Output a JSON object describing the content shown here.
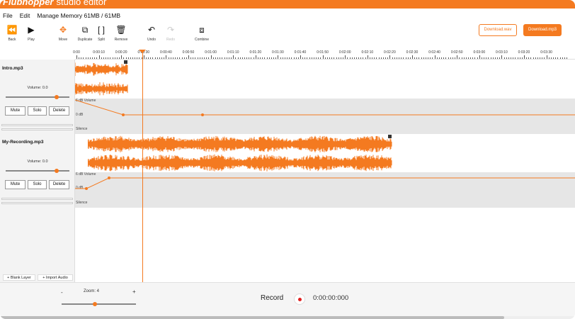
{
  "app": {
    "brand": "Flubhopper",
    "brand_sub": "studio editor"
  },
  "menu": {
    "file": "File",
    "edit": "Edit",
    "memory": "Manage Memory 61MB / 61MB"
  },
  "toolbar": {
    "back": "Back",
    "play": "Play",
    "move": "Move",
    "duplicate": "Duplicate",
    "split": "Split",
    "remove": "Remove",
    "undo": "Undo",
    "redo": "Redo",
    "combine": "Combine",
    "download_wav": "Download.wav",
    "download_mp3": "Download.mp3"
  },
  "ruler": {
    "ticks": [
      "0:00",
      "0:00:10",
      "0:00:20",
      "0:00:30",
      "0:00:40",
      "0:00:50",
      "0:01:00",
      "0:01:10",
      "0:01:20",
      "0:01:30",
      "0:01:40",
      "0:01:50",
      "0:02:00",
      "0:02:10",
      "0:02:20",
      "0:02:30",
      "0:02:40",
      "0:02:50",
      "0:03:00",
      "0:03:10",
      "0:03:20",
      "0:03:30"
    ]
  },
  "tracks": [
    {
      "name": "Intro.mp3",
      "volume_label": "Volume: 0.0",
      "volume_level": 0.8,
      "mute": "Mute",
      "solo": "Solo",
      "delete": "Delete",
      "env_volume": "6 dB Volume",
      "env_zero": "0 dB",
      "env_silence": "Silence"
    },
    {
      "name": "My-Recording.mp3",
      "volume_label": "Volume: 0.0",
      "volume_level": 0.8,
      "mute": "Mute",
      "solo": "Solo",
      "delete": "Delete",
      "env_volume": "6 dB Volume",
      "env_zero": "0 dB",
      "env_silence": "Silence"
    }
  ],
  "layers": {
    "blank": "+ Blank Layer",
    "import": "+ Import Audio"
  },
  "zoom": {
    "minus": "-",
    "plus": "+",
    "label": "Zoom: 4",
    "level": 0.45
  },
  "record": {
    "label": "Record",
    "time": "0:00:00:000"
  },
  "colors": {
    "accent": "#f47a20",
    "record": "#e02020",
    "envelope_bg": "#e6e6e6"
  }
}
